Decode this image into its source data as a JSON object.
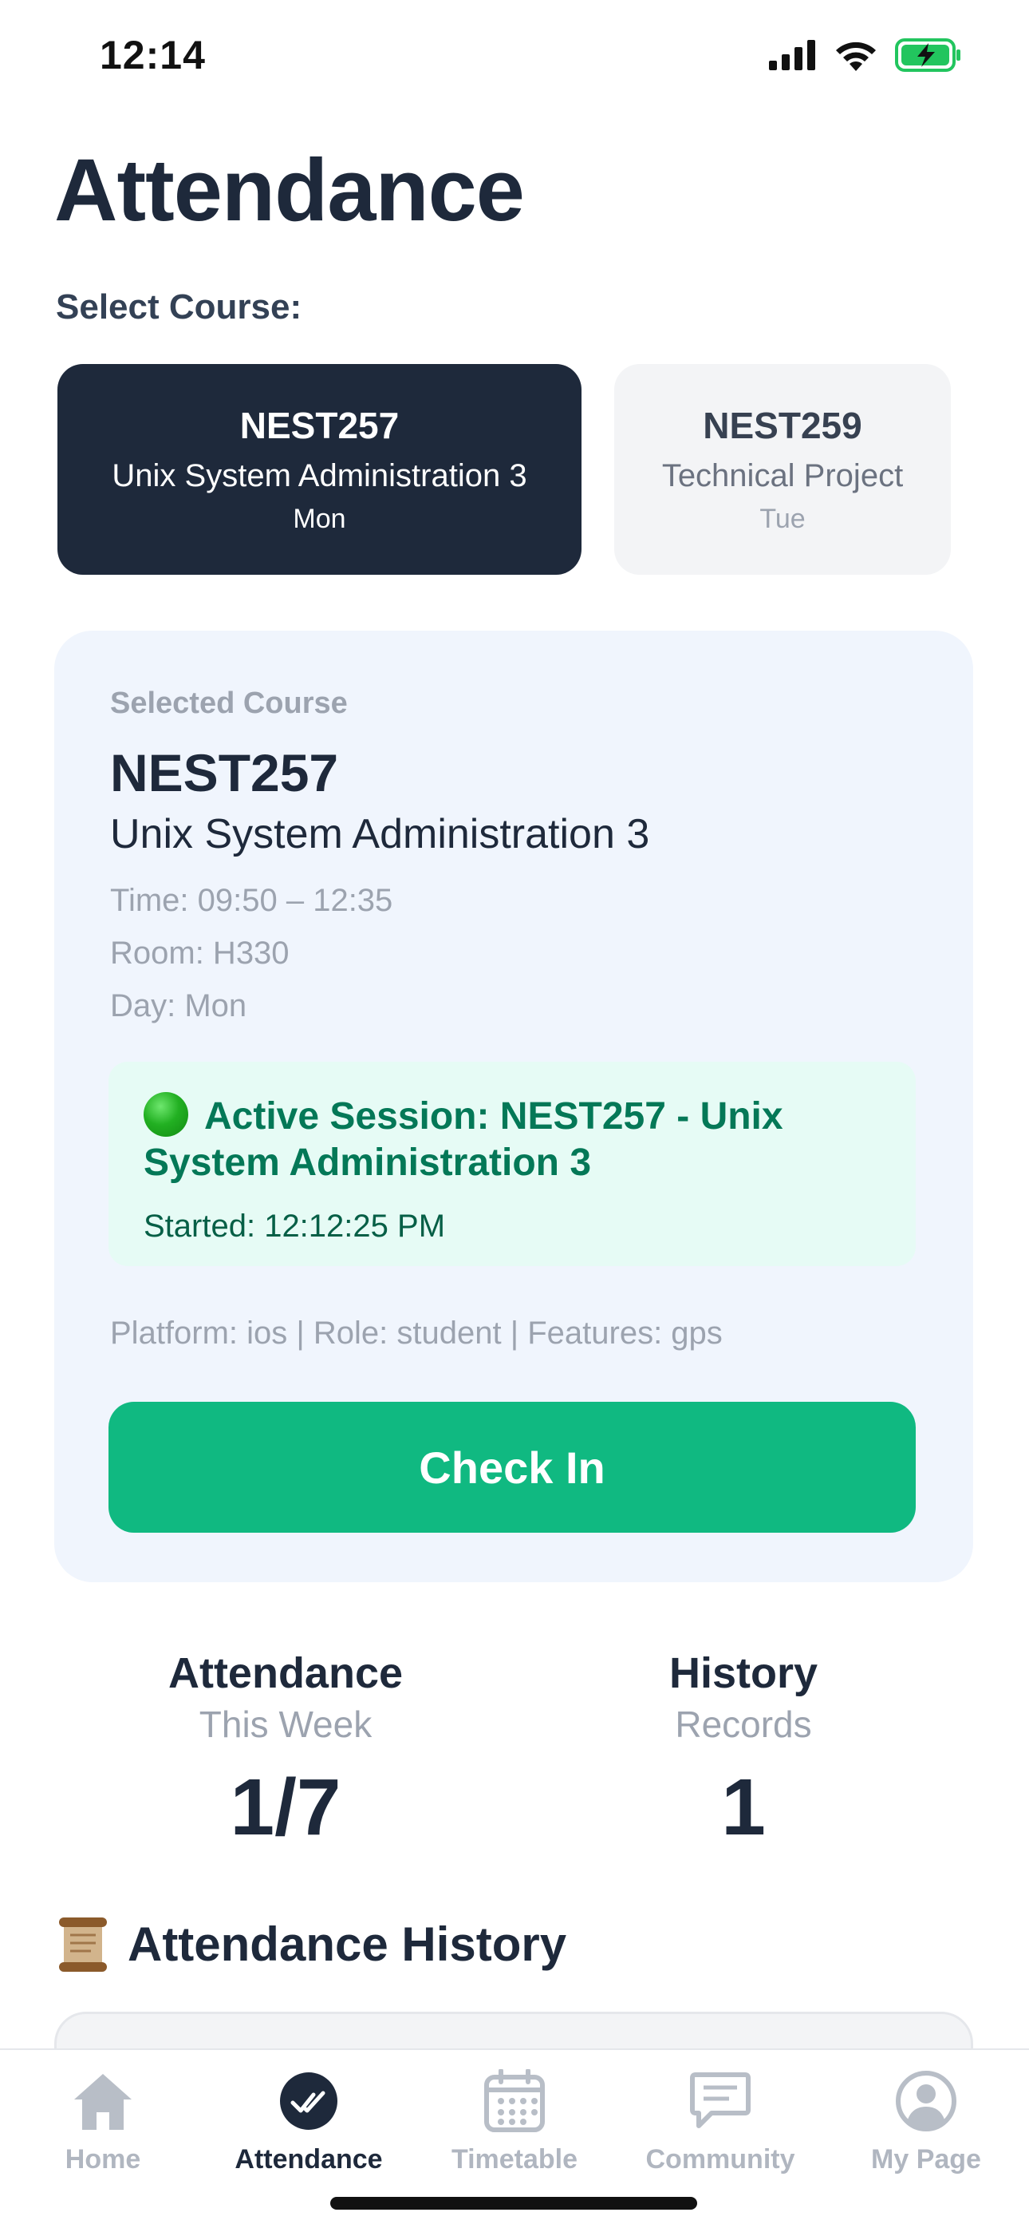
{
  "status_bar": {
    "time": "12:14",
    "icons": [
      "signal-icon",
      "wifi-icon",
      "battery-charging-icon"
    ]
  },
  "header": {
    "title": "Attendance",
    "select_label": "Select Course:"
  },
  "courses": [
    {
      "code": "NEST257",
      "name": "Unix System Administration 3",
      "day": "Mon",
      "selected": true
    },
    {
      "code": "NEST259",
      "name": "Technical Project",
      "day": "Tue",
      "selected": false
    }
  ],
  "selected_course": {
    "label": "Selected Course",
    "code": "NEST257",
    "name": "Unix System Administration 3",
    "time": "Time: 09:50 – 12:35",
    "room": "Room: H330",
    "day": "Day: Mon",
    "session": {
      "title": "Active Session: NEST257 - Unix System Administration 3",
      "started": "Started: 12:12:25 PM"
    },
    "platform_line": "Platform: ios | Role: student | Features: gps",
    "check_in_label": "Check In"
  },
  "stats": [
    {
      "title": "Attendance",
      "subtitle": "This Week",
      "value": "1/7"
    },
    {
      "title": "History",
      "subtitle": "Records",
      "value": "1"
    }
  ],
  "history": {
    "heading": "Attendance History",
    "icon": "scroll-icon"
  },
  "tab_bar": {
    "tabs": [
      {
        "label": "Home",
        "icon": "home-icon",
        "active": false
      },
      {
        "label": "Attendance",
        "icon": "check-circle-icon",
        "active": true
      },
      {
        "label": "Timetable",
        "icon": "calendar-icon",
        "active": false
      },
      {
        "label": "Community",
        "icon": "chat-icon",
        "active": false
      },
      {
        "label": "My Page",
        "icon": "user-icon",
        "active": false
      }
    ]
  },
  "colors": {
    "primary_dark": "#1e293b",
    "accent_green": "#10b981",
    "session_bg": "#e6fbf5",
    "panel_bg": "#f0f5fd",
    "muted": "#9ca3af"
  }
}
